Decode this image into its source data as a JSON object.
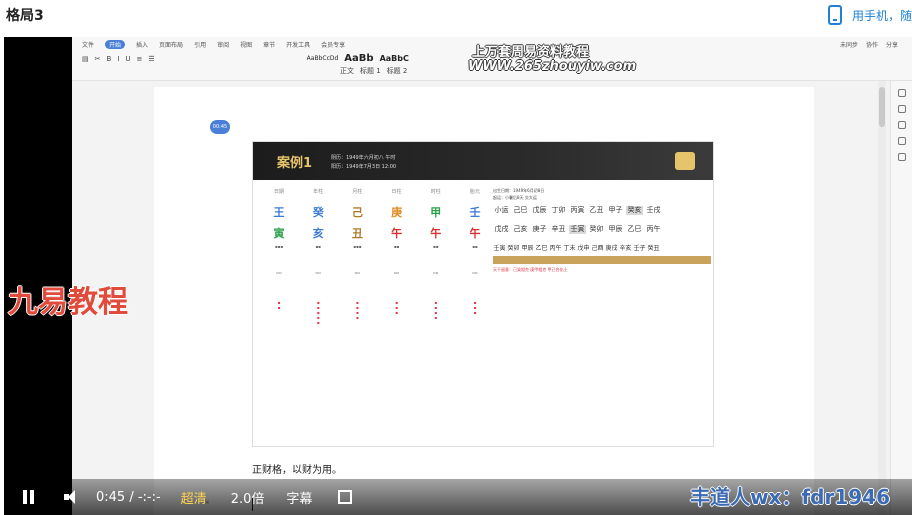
{
  "page": {
    "title": "格局3",
    "phone_promo": "用手机，随"
  },
  "toolbar": {
    "menus": [
      "文件",
      "开始",
      "插入",
      "页面布局",
      "引用",
      "审阅",
      "视图",
      "章节",
      "开发工具",
      "会员专享"
    ],
    "active_menu": "开始",
    "style_samples": [
      "AaBbCcDd",
      "AaBb",
      "AaBbC"
    ],
    "style_names": [
      "正文",
      "标题 1",
      "标题 2"
    ],
    "right_tools": [
      "未同步",
      "协作",
      "分享"
    ]
  },
  "watermarks": {
    "top_line": "上万套周易资料教程",
    "url_line": "WWW.265zhouyiw.com",
    "left_overlay": "九易教程",
    "bottom_right": "丰道人wx：fdr1946"
  },
  "document": {
    "page_badge": "00:45",
    "chart": {
      "banner_title": "案例1",
      "banner_line1": "阴历：1949年六月初八 午时",
      "banner_line2": "阳历：1949年7月3日 12:00",
      "stem_labels": [
        "日期",
        "年柱",
        "月柱",
        "日柱",
        "时柱",
        "胎元"
      ],
      "heavenly_stems": [
        "王",
        "癸",
        "己",
        "庚",
        "甲",
        "壬"
      ],
      "earthly_branches": [
        "寅",
        "亥",
        "丑",
        "午",
        "午",
        "午"
      ],
      "info_lines": [
        "出生日期：1949年6月初8日",
        "起运：小暑后8天 交大运"
      ],
      "dayun": [
        "小运",
        "己巳",
        "戊辰",
        "丁卯",
        "丙寅",
        "乙丑",
        "甲子",
        "癸亥",
        "壬戌"
      ],
      "liunian": [
        "戊戌",
        "己亥",
        "庚子",
        "辛丑",
        "壬寅",
        "癸卯",
        "甲辰",
        "乙巳",
        "丙午"
      ],
      "liuyue": [
        "壬寅",
        "癸卯",
        "甲辰",
        "乙巳",
        "丙午",
        "丁未",
        "戊申",
        "己酉",
        "庚戌",
        "辛亥",
        "壬子",
        "癸丑"
      ],
      "notes": [
        "天干留意：己癸相克 庚甲相克 甲己合化土"
      ]
    },
    "body_text": "正财格，以财为用。"
  },
  "player": {
    "time": "0:45 / -:-:-",
    "quality": "超清",
    "speed": "2.0倍",
    "subtitle": "字幕"
  }
}
